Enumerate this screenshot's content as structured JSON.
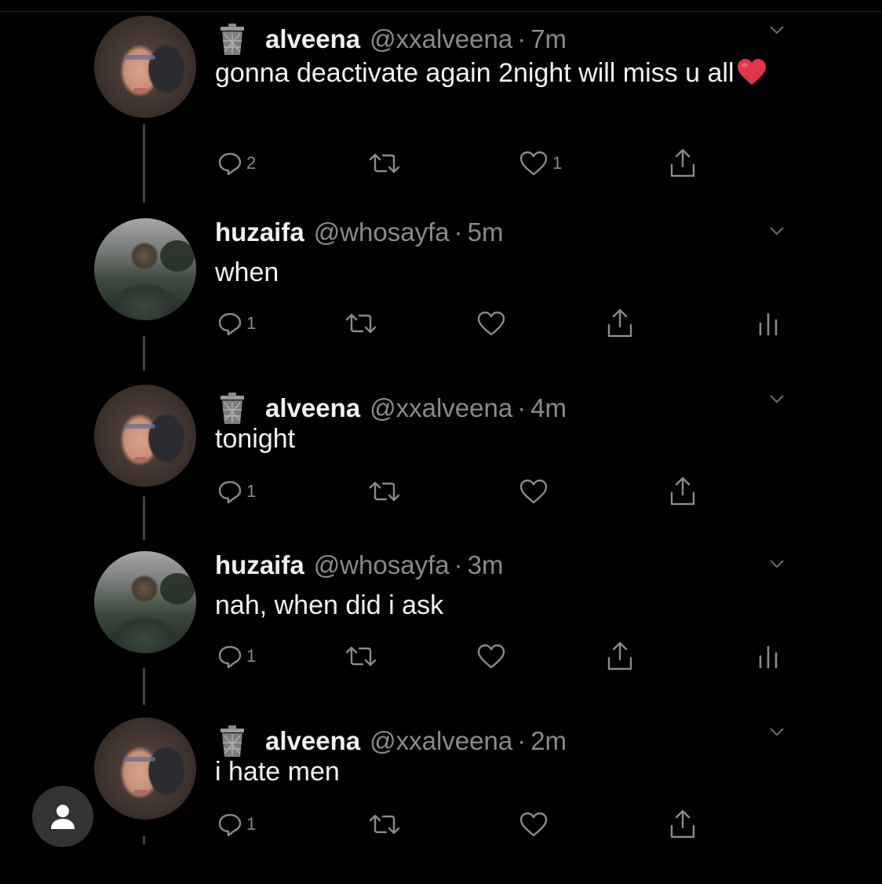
{
  "tweets": [
    {
      "name": "alveena",
      "handle": "@xxalveena",
      "time": "7m",
      "text": "gonna deactivate again 2night will miss u all",
      "emoji": "heart",
      "replies": "2",
      "likes": "1"
    },
    {
      "name": "huzaifa",
      "handle": "@whosayfa",
      "time": "5m",
      "text": "when",
      "replies": "1",
      "likes": ""
    },
    {
      "name": "alveena",
      "handle": "@xxalveena",
      "time": "4m",
      "text": "tonight",
      "replies": "1",
      "likes": ""
    },
    {
      "name": "huzaifa",
      "handle": "@whosayfa",
      "time": "3m",
      "text": "nah, when did i ask",
      "replies": "1",
      "likes": ""
    },
    {
      "name": "alveena",
      "handle": "@xxalveena",
      "time": "2m",
      "text": "i hate men",
      "replies": "1",
      "likes": ""
    }
  ],
  "separator": "·",
  "icons": {
    "reply": "reply-icon",
    "retweet": "retweet-icon",
    "like": "heart-icon",
    "share": "share-icon",
    "analytics": "analytics-icon",
    "more": "chevron-down-icon",
    "trash": "trash-emoji-icon",
    "account": "user-icon"
  },
  "colors": {
    "background": "#000000",
    "text": "#f2f2f2",
    "muted": "#8a8a8a",
    "heart": "#e0245e"
  }
}
